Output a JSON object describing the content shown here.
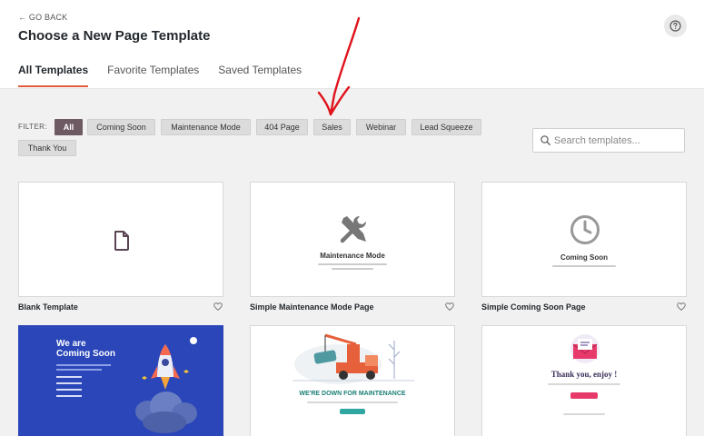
{
  "header": {
    "go_back": "← GO BACK",
    "title": "Choose a New Page Template",
    "help_icon": "question-circle-icon"
  },
  "tabs": [
    {
      "label": "All Templates",
      "active": true
    },
    {
      "label": "Favorite Templates",
      "active": false
    },
    {
      "label": "Saved Templates",
      "active": false
    }
  ],
  "filter": {
    "label": "FILTER:",
    "chips": [
      {
        "label": "All",
        "active": true
      },
      {
        "label": "Coming Soon",
        "active": false
      },
      {
        "label": "Maintenance Mode",
        "active": false
      },
      {
        "label": "404 Page",
        "active": false
      },
      {
        "label": "Sales",
        "active": false
      },
      {
        "label": "Webinar",
        "active": false
      },
      {
        "label": "Lead Squeeze",
        "active": false
      },
      {
        "label": "Thank You",
        "active": false
      }
    ]
  },
  "search": {
    "placeholder": "Search templates...",
    "value": ""
  },
  "templates": [
    {
      "label": "Blank Template",
      "icon": "document-icon"
    },
    {
      "label": "Simple Maintenance Mode Page",
      "preview_title": "Maintenance Mode",
      "icon": "tools-icon"
    },
    {
      "label": "Simple Coming Soon Page",
      "preview_title": "Coming Soon",
      "icon": "clock-icon"
    },
    {
      "label": "",
      "preview_title": "We are\nComing Soon",
      "icon": "rocket-icon"
    },
    {
      "label": "",
      "preview_title": "WE'RE DOWN FOR MAINTENANCE",
      "icon": "tow-truck-icon"
    },
    {
      "label": "",
      "preview_title": "Thank you, enjoy !",
      "icon": "envelope-icon"
    }
  ],
  "colors": {
    "accent": "#df5b3a",
    "chip_active": "#6e5a63",
    "coming_soon_bg": "#2a46b8",
    "teal": "#1b7f75",
    "pink": "#e8396b"
  }
}
